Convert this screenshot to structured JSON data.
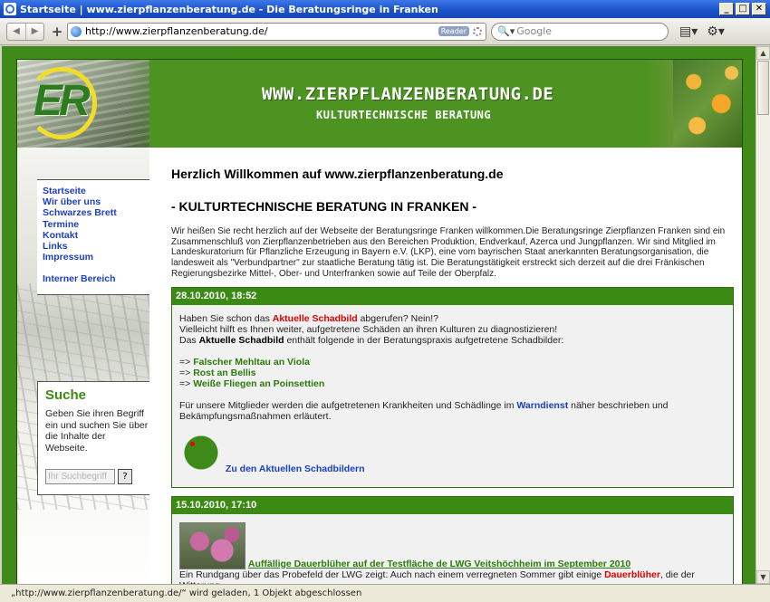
{
  "window": {
    "title": "Startseite | www.zierpflanzenberatung.de - Die Beratungsringe in Franken",
    "controls": [
      "_",
      "□",
      "✕"
    ]
  },
  "toolbar": {
    "back": "◀",
    "forward": "▶",
    "new_tab": "+",
    "url": "http://www.zierpflanzenberatung.de/",
    "reader": "Reader",
    "search_placeholder": "Google",
    "search_prefix": "🔍▾",
    "page_menu": "▤▾",
    "tools_menu": "⚙▾"
  },
  "header": {
    "logo": "ER",
    "site_title": "WWW.ZIERPFLANZENBERATUNG.DE",
    "site_subtitle": "KULTURTECHNISCHE BERATUNG"
  },
  "nav": {
    "items": [
      "Startseite",
      "Wir über uns",
      "Schwarzes Brett",
      "Termine",
      "Kontakt",
      "Links",
      "Impressum"
    ],
    "internal": "Interner Bereich"
  },
  "search": {
    "title": "Suche",
    "text": "Geben Sie ihren Begriff ein und suchen Sie über die Inhalte der Webseite.",
    "placeholder": "Ihr Suchbegriff",
    "button": "?"
  },
  "main": {
    "welcome": "Herzlich Willkommen auf www.zierpflanzenberatung.de",
    "subtitle": "- KULTURTECHNISCHE BERATUNG IN FRANKEN -",
    "intro": "Wir heißen Sie recht herzlich auf der Webseite der Beratungsringe Franken willkommen.Die Beratungsringe Zierpflanzen Franken sind ein Zusammenschluß von Zierpflanzenbetrieben aus den Bereichen Produktion, Endverkauf, Azerca und Jungpflanzen. Wir sind Mitglied im Landeskuratorium für Pflanzliche Erzeugung in Bayern e.V. (LKP), eine vom bayrischen Staat anerkannten Beratungsorganisation, die landesweit als \"Verbundpartner\" zur staatliche Beratung tätig ist. Die Beratungstätigkeit erstreckt sich derzeit auf die drei Fränkischen Regierungsbezirke Mittel-, Ober- und Unterfranken sowie auf Teile der Oberpfalz."
  },
  "news1": {
    "date": "28.10.2010, 18:52",
    "l1a": "Haben Sie schon das ",
    "l1b": "Aktuelle Schadbild",
    "l1c": " abgerufen? Nein!?",
    "l2": "Vielleicht hilft es Ihnen weiter, aufgetretene Schäden an ihren Kulturen zu diagnostizieren!",
    "l3a": "Das ",
    "l3b": "Aktuelle Schadbild",
    "l3c": " enthält folgende in der Beratungspraxis aufgetretene Schadbilder:",
    "arrow": "=> ",
    "items": [
      "Falscher Mehltau an Viola",
      "Rost an Bellis",
      "Weiße Fliegen an Poinsettien"
    ],
    "l4a": "Für unsere Mitglieder werden die aufgetretenen Krankheiten und Schädlinge im ",
    "l4b": "Warndienst",
    "l4c": " näher beschrieben und Bekämpfungsmaßnahmen erläutert.",
    "link": "Zu den Aktuellen Schadbildern"
  },
  "news2": {
    "date": "15.10.2010, 17:10",
    "link": "Auffällige Dauerblüher auf der Testfläche de LWG Veitshöchheim im September 2010",
    "l1a": "Ein Rundgang über das Probefeld der LWG zeigt: Auch nach einem verregneten Sommer gibt einige ",
    "l1b": "Dauerblüher",
    "l1c": ", die der Witterung"
  },
  "status": {
    "text": "„http://www.zierpflanzenberatung.de/“ wird geladen, 1 Objekt abgeschlossen"
  },
  "colors": {
    "frame_green": "#3f8a18",
    "header_green": "#4c9322",
    "news_header": "#3b8a14",
    "link_blue": "#1b3fc0",
    "accent_red": "#e00000"
  }
}
